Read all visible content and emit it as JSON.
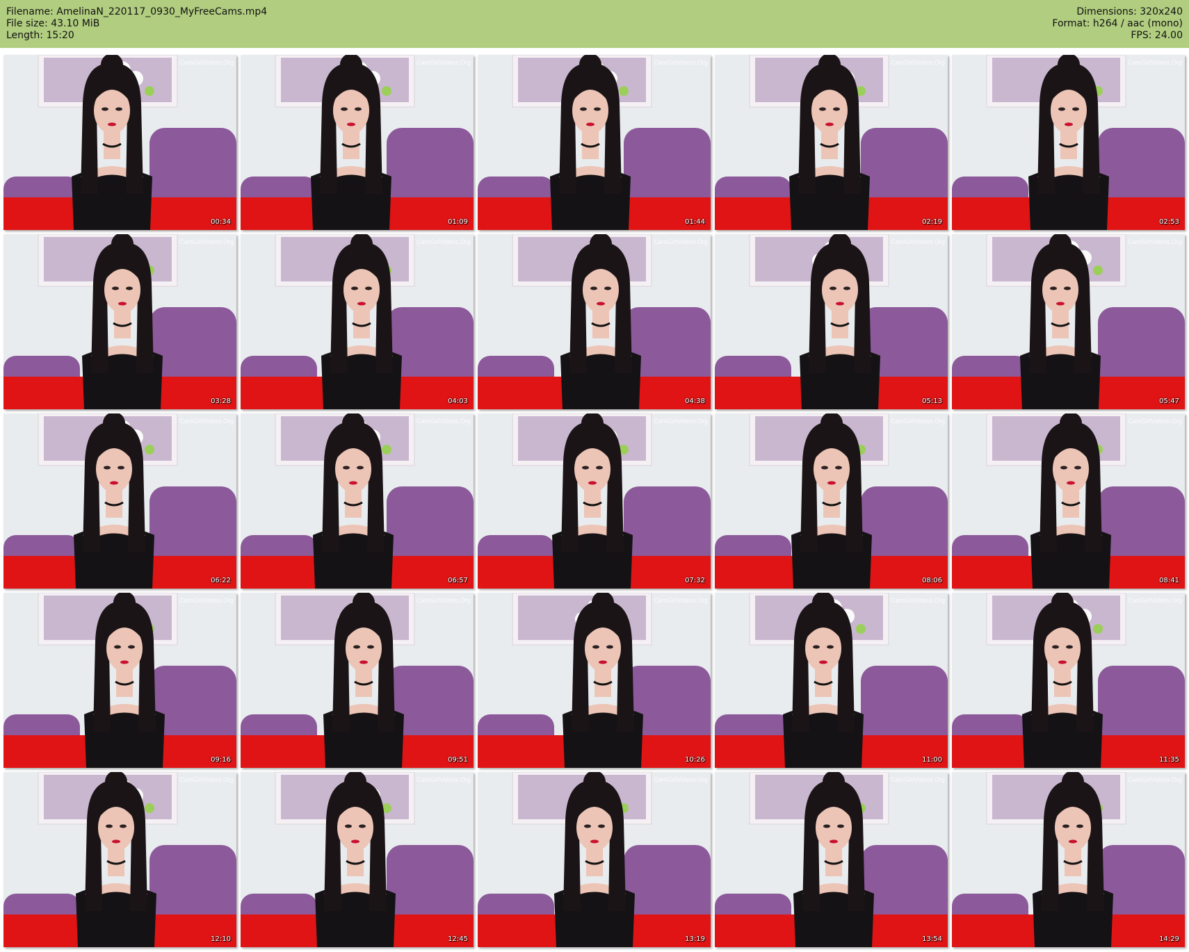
{
  "header": {
    "filename_line": "Filename: AmelinaN_220117_0930_MyFreeCams.mp4",
    "filesize_line": "File size: 43.10 MiB",
    "length_line": "Length: 15:20",
    "dimensions_line": "Dimensions: 320x240",
    "format_line": "Format: h264 / aac (mono)",
    "fps_line": "FPS: 24.00"
  },
  "colors": {
    "header_bg": "#b1cd80",
    "wall": "#e9ecef",
    "sofa": "#8c5a9a",
    "floor": "#e01414",
    "hair": "#1b1417",
    "top": "#141214",
    "skin": "#ecc5b6"
  },
  "watermark": "CamGirlVideos.Org",
  "thumbnails": [
    {
      "timestamp": "00:34"
    },
    {
      "timestamp": "01:09"
    },
    {
      "timestamp": "01:44"
    },
    {
      "timestamp": "02:19"
    },
    {
      "timestamp": "02:53"
    },
    {
      "timestamp": "03:28"
    },
    {
      "timestamp": "04:03"
    },
    {
      "timestamp": "04:38"
    },
    {
      "timestamp": "05:13"
    },
    {
      "timestamp": "05:47"
    },
    {
      "timestamp": "06:22"
    },
    {
      "timestamp": "06:57"
    },
    {
      "timestamp": "07:32"
    },
    {
      "timestamp": "08:06"
    },
    {
      "timestamp": "08:41"
    },
    {
      "timestamp": "09:16"
    },
    {
      "timestamp": "09:51"
    },
    {
      "timestamp": "10:26"
    },
    {
      "timestamp": "11:00"
    },
    {
      "timestamp": "11:35"
    },
    {
      "timestamp": "12:10"
    },
    {
      "timestamp": "12:45"
    },
    {
      "timestamp": "13:19"
    },
    {
      "timestamp": "13:54"
    },
    {
      "timestamp": "14:29"
    }
  ]
}
